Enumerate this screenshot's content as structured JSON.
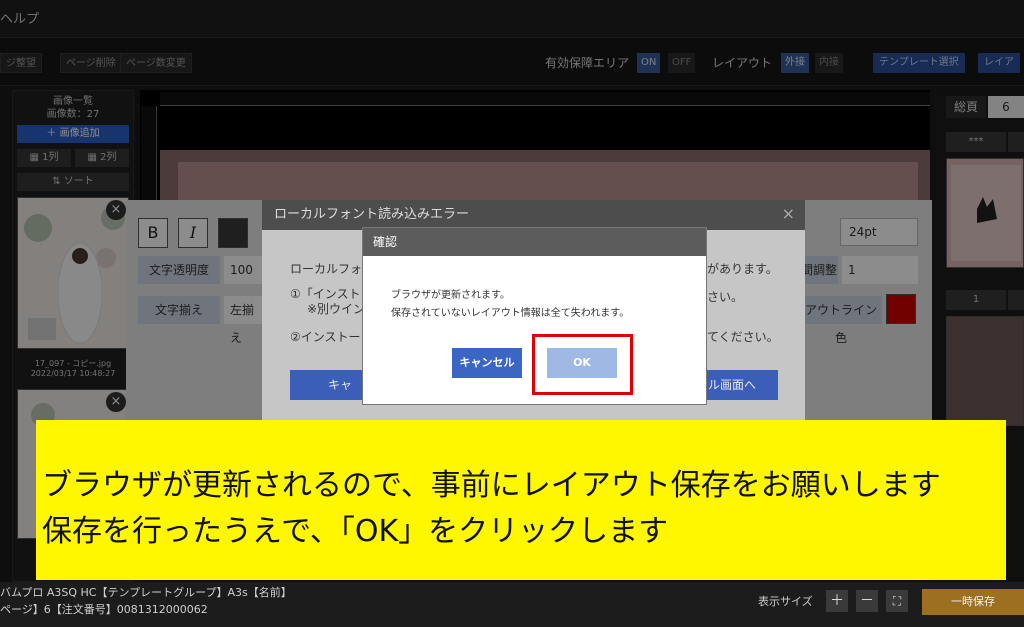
{
  "menubar": {
    "help": "ヘルプ"
  },
  "toolbar": {
    "btn_reorder": "ジ整望",
    "btn_delete_page": "ページ削除",
    "btn_change_count": "ページ数変更",
    "safe_area_label": "有効保障エリア",
    "safe_on": "ON",
    "safe_off": "OFF",
    "layout_label": "レイアウト",
    "layout_outer": "外接",
    "layout_inner": "内接",
    "template_select": "テンプレート選択",
    "layout_trunc": "レイア"
  },
  "left_panel": {
    "title": "画像一覧",
    "count": "画像数：27",
    "add_button": "＋ 画像追加",
    "col1": "▦ 1列",
    "col2": "▦ 2列",
    "sort": "⇅ ソート",
    "thumb1_name": "17_097 - コピー.jpg",
    "thumb1_date": "2022/03/17 10:48:27"
  },
  "right_panel": {
    "total_label": "総頁",
    "total_value": "6",
    "chip1": "***",
    "chip2": "1"
  },
  "text_panel": {
    "bold": "B",
    "italic": "I",
    "opacity_label": "文字透明度",
    "opacity_value": "100",
    "align_label": "文字揃え",
    "align_value": "左揃え",
    "size_value": "24pt",
    "spacing_label": "間調整",
    "spacing_value": "1",
    "outline_label": "アウトライン色"
  },
  "error_dialog": {
    "title": "ローカルフォント読み込みエラー",
    "close": "×",
    "line1_left": "ローカルフォ",
    "line1_right": "があります。",
    "line2_left": "①「インスト",
    "line2_right": "さい。",
    "line3_left": "※別ウイン",
    "line4_left": "②インストー",
    "line4_right": "てください。",
    "btn_left": "キャ",
    "btn_right": "ール画面へ"
  },
  "confirm_dialog": {
    "title": "確認",
    "message_1": "ブラウザが更新されます。",
    "message_2": "保存されていないレイアウト情報は全て失われます。",
    "cancel": "キャンセル",
    "ok": "OK"
  },
  "caption": {
    "line1": "ブラウザが更新されるので、事前にレイアウト保存をお願いします",
    "line2": "保存を行ったうえで、「OK」をクリックします"
  },
  "bottom_bar": {
    "info1": "バムプロ A3SQ HC【テンプレートグループ】A3s【名前】",
    "info2": "ページ】6【注文番号】0081312000062",
    "size_label": "表示サイズ",
    "zoom_in": "＋",
    "zoom_out": "－",
    "fit": "⛶",
    "save": "一時保存"
  },
  "colors": {
    "accent_blue": "#2d5fc8",
    "highlight_red": "#e00000",
    "caption_yellow": "#fff700",
    "save_gold": "#9c7020"
  }
}
